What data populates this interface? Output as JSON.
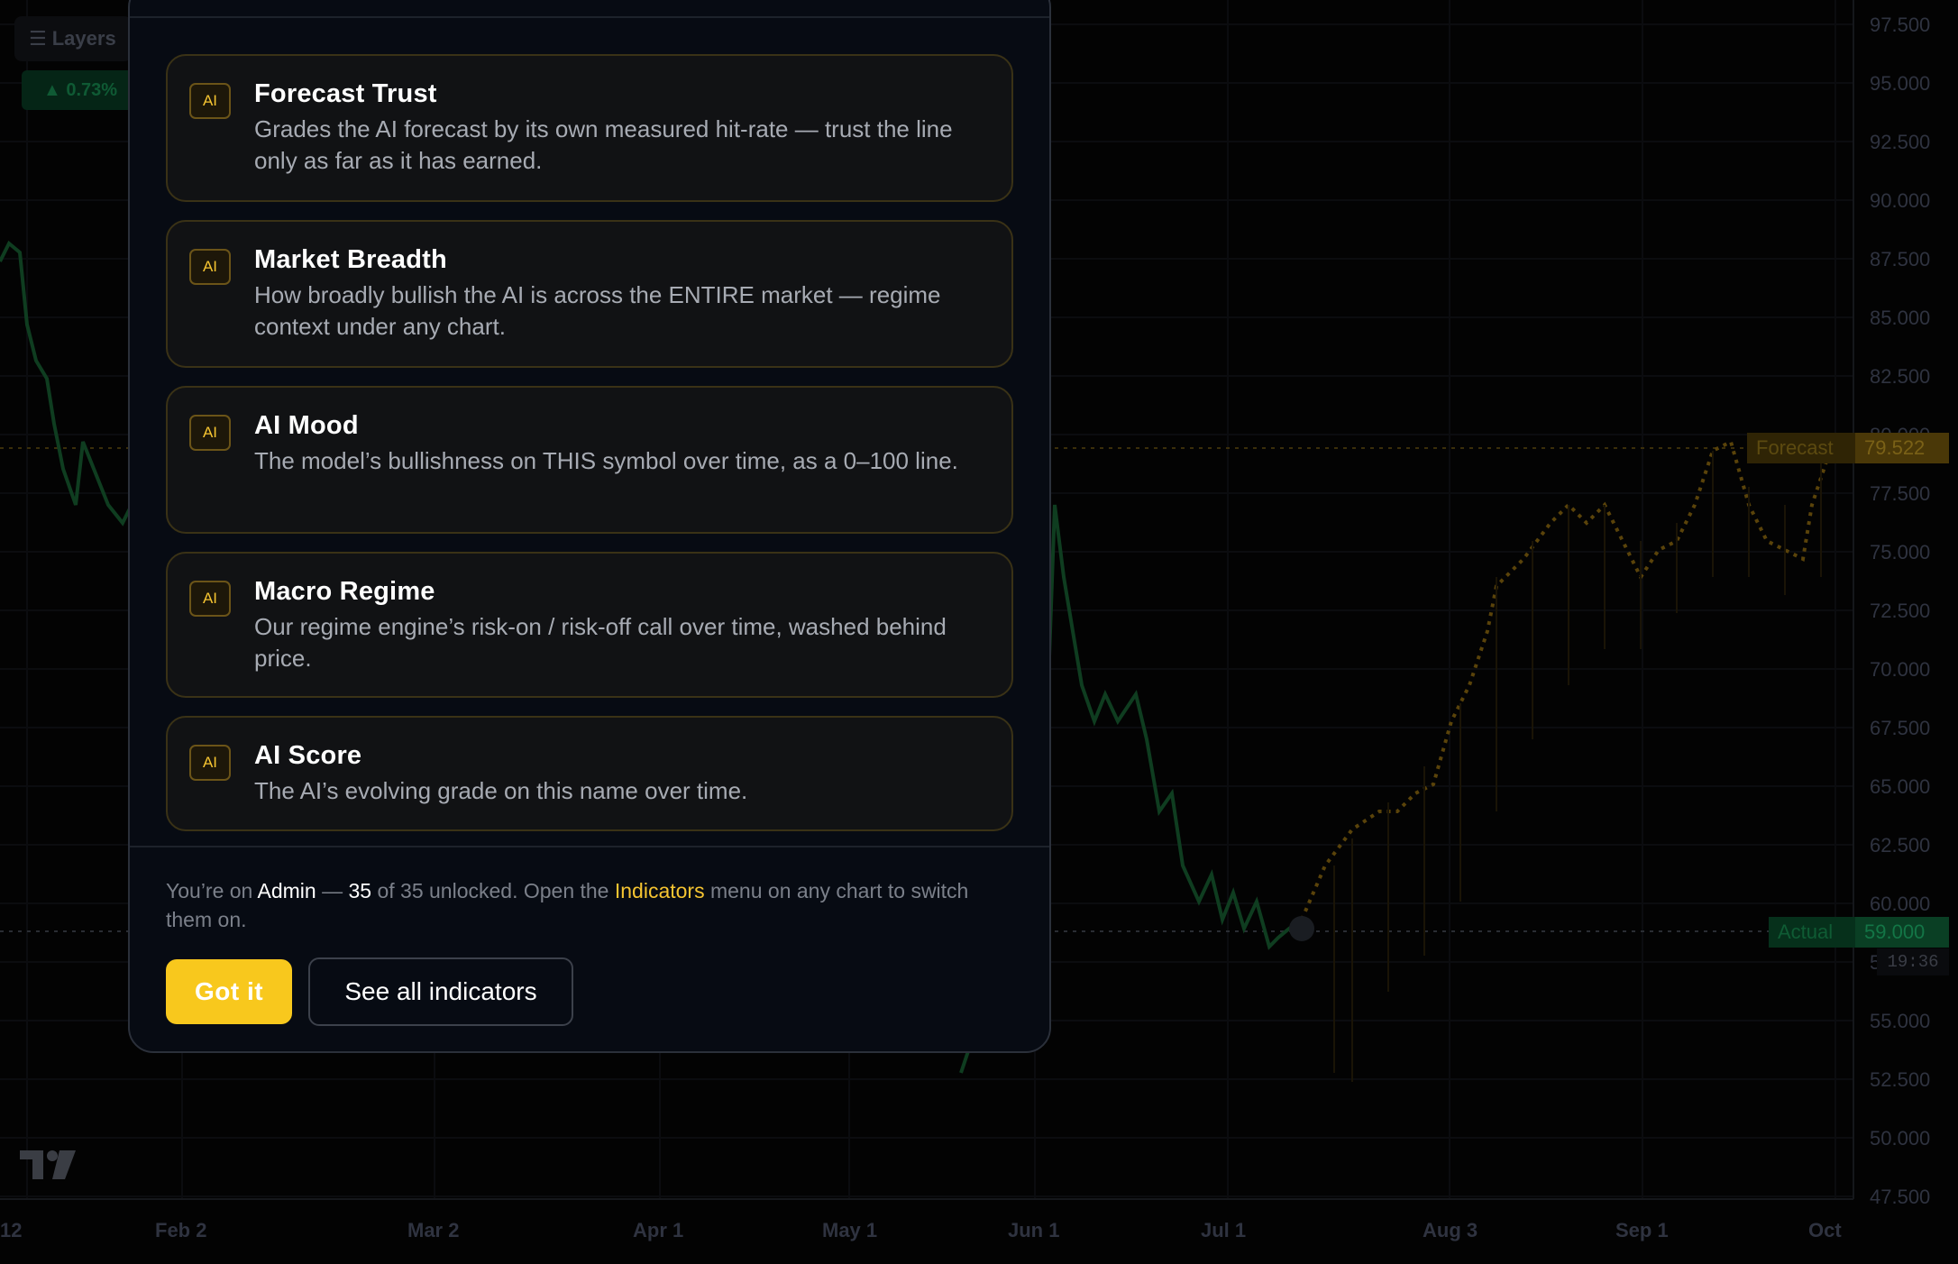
{
  "toolbar": {
    "layers_label": "Layers",
    "change_badge": "▲ 0.73%"
  },
  "price_axis": [
    "97.500",
    "95.000",
    "92.500",
    "90.000",
    "87.500",
    "85.000",
    "82.500",
    "80.000",
    "77.500",
    "75.000",
    "72.500",
    "70.000",
    "67.500",
    "65.000",
    "62.500",
    "60.000",
    "57.500",
    "55.000",
    "52.500",
    "50.000",
    "47.500"
  ],
  "time_axis": [
    "12",
    "Feb 2",
    "Mar 2",
    "Apr 1",
    "May 1",
    "Jun 1",
    "Jul 1",
    "Aug 3",
    "Sep 1",
    "Oct"
  ],
  "markers": {
    "forecast_label": "Forecast",
    "forecast_value": "79.522",
    "actual_label": "Actual",
    "actual_value": "59.000",
    "countdown": "19:36"
  },
  "colors": {
    "accent": "#f8c81d",
    "actual_line": "#1f7a3e",
    "forecast_line": "#b8860b"
  },
  "modal": {
    "indicators": [
      {
        "badge": "AI",
        "title": "Forecast Trust",
        "description": "Grades the AI forecast by its own measured hit-rate — trust the line only as far as it has earned."
      },
      {
        "badge": "AI",
        "title": "Market Breadth",
        "description": "How broadly bullish the AI is across the ENTIRE market — regime context under any chart."
      },
      {
        "badge": "AI",
        "title": "AI Mood",
        "description": "The model’s bullishness on THIS symbol over time, as a 0–100 line."
      },
      {
        "badge": "AI",
        "title": "Macro Regime",
        "description": "Our regime engine’s risk-on / risk-off call over time, washed behind price."
      },
      {
        "badge": "AI",
        "title": "AI Score",
        "description": "The AI’s evolving grade on this name over time."
      }
    ],
    "footer": {
      "prefix": "You’re on",
      "plan": "Admin",
      "dash": "—",
      "unlocked_count": "35",
      "unlocked_rest": "of 35 unlocked. Open the",
      "menu_name": "Indicators",
      "suffix": "menu on any chart to switch them on."
    },
    "primary_button": "Got it",
    "secondary_button": "See all indicators"
  }
}
